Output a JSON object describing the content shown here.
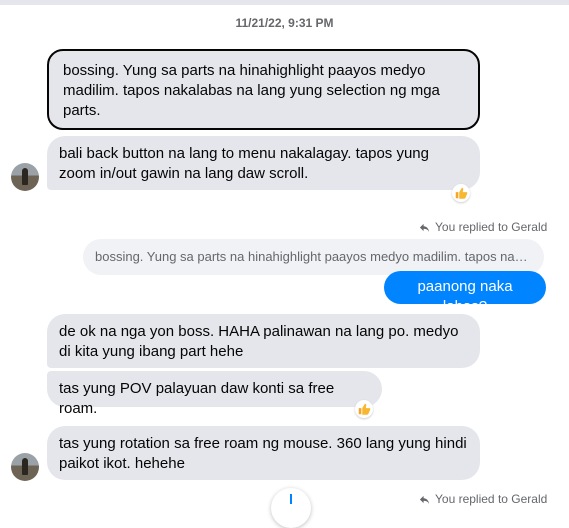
{
  "thread": {
    "timestamp": "11/21/22, 9:31 PM"
  },
  "messages": {
    "m1": "bossing. Yung sa parts na hinahighlight paayos medyo madilim. tapos nakalabas na lang yung selection ng mga parts.",
    "m2": "bali back button na lang to menu nakalagay. tapos yung zoom in/out gawin na lang daw scroll.",
    "reply_label_1": "You replied to Gerald",
    "quoted": "bossing. Yung sa parts na hinahighlight paayos medyo madilim. tapos naka...",
    "outgoing": "paanong naka labas?",
    "m4": "de ok na nga yon boss. HAHA palinawan na lang po. medyo di kita yung ibang part hehe",
    "m5": "tas yung POV palayuan daw konti sa free roam.",
    "m6": "tas yung rotation sa free roam ng mouse. 360 lang yung hindi paikot ikot. hehehe",
    "reply_label_2": "You replied to Gerald"
  },
  "reactions": [
    "thumbs-up",
    "thumbs-up"
  ],
  "colors": {
    "incoming_bubble": "#e4e6eb",
    "outgoing_bubble": "#0084ff",
    "meta_text": "#65676b"
  }
}
